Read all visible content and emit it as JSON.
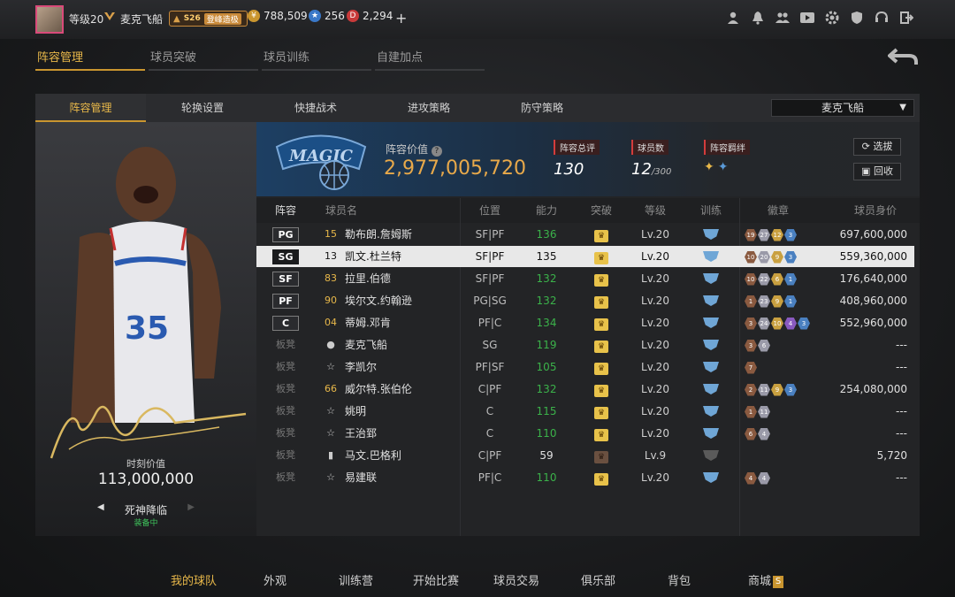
{
  "top": {
    "level": "等级20",
    "username": "麦克飞船",
    "season": {
      "code": "S26",
      "tier": "登峰造极"
    },
    "currencies": [
      {
        "icon": "gold-coin-icon",
        "value": "788,509",
        "color": "#c9952f"
      },
      {
        "icon": "blue-star-icon",
        "value": "256",
        "color": "#3a78c8"
      },
      {
        "icon": "red-diamond-icon",
        "value": "2,294",
        "color": "#c83a3a"
      }
    ],
    "add": "+"
  },
  "main_tabs": [
    "阵容管理",
    "球员突破",
    "球员训练",
    "自建加点"
  ],
  "sub_tabs": [
    "阵容管理",
    "轮换设置",
    "快捷战术",
    "进攻策略",
    "防守策略"
  ],
  "team_select": "麦克飞船",
  "card": {
    "moment_label": "时刻价值",
    "moment_value": "113,000,000",
    "skill_name": "死神降临",
    "skill_state": "装备中"
  },
  "team": {
    "value_label": "阵容价值",
    "value": "2,977,005,720",
    "overall_label": "阵容总评",
    "overall": "130",
    "players_label": "球员数",
    "players": "12",
    "players_max": "/300",
    "bond_label": "阵容羁绊",
    "select_btn": "选拔",
    "recycle_btn": "回收"
  },
  "columns": [
    "阵容",
    "球员名",
    "位置",
    "能力",
    "突破",
    "等级",
    "训练",
    "徽章",
    "球员身价"
  ],
  "rows": [
    {
      "slot": "PG",
      "num": "15",
      "name": "勒布朗.詹姆斯",
      "pos": "SF|PF",
      "ability": "136",
      "level": "Lv.20",
      "badges": [
        [
          "19",
          "br"
        ],
        [
          "27",
          "sv"
        ],
        [
          "12",
          "gd"
        ],
        [
          "3",
          "bl"
        ]
      ],
      "value": "697,600,000"
    },
    {
      "slot": "SG",
      "num": "13",
      "name": "凯文.杜兰特",
      "pos": "SF|PF",
      "ability": "135",
      "level": "Lv.20",
      "badges": [
        [
          "10",
          "br"
        ],
        [
          "20",
          "sv"
        ],
        [
          "9",
          "gd"
        ],
        [
          "3",
          "bl"
        ]
      ],
      "value": "559,360,000"
    },
    {
      "slot": "SF",
      "num": "83",
      "name": "拉里.伯德",
      "pos": "SF|PF",
      "ability": "132",
      "level": "Lv.20",
      "badges": [
        [
          "10",
          "br"
        ],
        [
          "22",
          "sv"
        ],
        [
          "6",
          "gd"
        ],
        [
          "1",
          "bl"
        ]
      ],
      "value": "176,640,000"
    },
    {
      "slot": "PF",
      "num": "90",
      "name": "埃尔文.约翰逊",
      "pos": "PG|SG",
      "ability": "132",
      "level": "Lv.20",
      "badges": [
        [
          "1",
          "br"
        ],
        [
          "23",
          "sv"
        ],
        [
          "9",
          "gd"
        ],
        [
          "1",
          "bl"
        ]
      ],
      "value": "408,960,000"
    },
    {
      "slot": "C",
      "num": "04",
      "name": "蒂姆.邓肯",
      "pos": "PF|C",
      "ability": "134",
      "level": "Lv.20",
      "badges": [
        [
          "3",
          "br"
        ],
        [
          "24",
          "sv"
        ],
        [
          "10",
          "gd"
        ],
        [
          "4",
          "pu"
        ],
        [
          "3",
          "bl"
        ]
      ],
      "value": "552,960,000"
    },
    {
      "slot": "板凳",
      "num": "",
      "name": "麦克飞船",
      "pos": "SG",
      "ability": "119",
      "level": "Lv.20",
      "badges": [
        [
          "3",
          "br"
        ],
        [
          "6",
          "sv"
        ]
      ],
      "value": "---"
    },
    {
      "slot": "板凳",
      "num": "",
      "name": "李凯尔",
      "pos": "PF|SF",
      "ability": "105",
      "level": "Lv.20",
      "badges": [
        [
          "7",
          "br"
        ]
      ],
      "value": "---"
    },
    {
      "slot": "板凳",
      "num": "66",
      "name": "威尔特.张伯伦",
      "pos": "C|PF",
      "ability": "132",
      "level": "Lv.20",
      "badges": [
        [
          "2",
          "br"
        ],
        [
          "11",
          "sv"
        ],
        [
          "9",
          "gd"
        ],
        [
          "3",
          "bl"
        ]
      ],
      "value": "254,080,000"
    },
    {
      "slot": "板凳",
      "num": "",
      "name": "姚明",
      "pos": "C",
      "ability": "115",
      "level": "Lv.20",
      "badges": [
        [
          "1",
          "br"
        ],
        [
          "11",
          "sv"
        ]
      ],
      "value": "---"
    },
    {
      "slot": "板凳",
      "num": "",
      "name": "王治郅",
      "pos": "C",
      "ability": "110",
      "level": "Lv.20",
      "badges": [
        [
          "6",
          "br"
        ],
        [
          "4",
          "sv"
        ]
      ],
      "value": "---"
    },
    {
      "slot": "板凳",
      "num": "",
      "name": "马文.巴格利",
      "pos": "C|PF",
      "ability": "59",
      "level": "Lv.9",
      "badges": [],
      "value": "5,720"
    },
    {
      "slot": "板凳",
      "num": "",
      "name": "易建联",
      "pos": "PF|C",
      "ability": "110",
      "level": "Lv.20",
      "badges": [
        [
          "4",
          "br"
        ],
        [
          "4",
          "sv"
        ]
      ],
      "value": "---"
    }
  ],
  "bottom_nav": [
    "我的球队",
    "外观",
    "训练营",
    "开始比赛",
    "球员交易",
    "俱乐部",
    "背包",
    "商城"
  ],
  "shop_badge": "S"
}
